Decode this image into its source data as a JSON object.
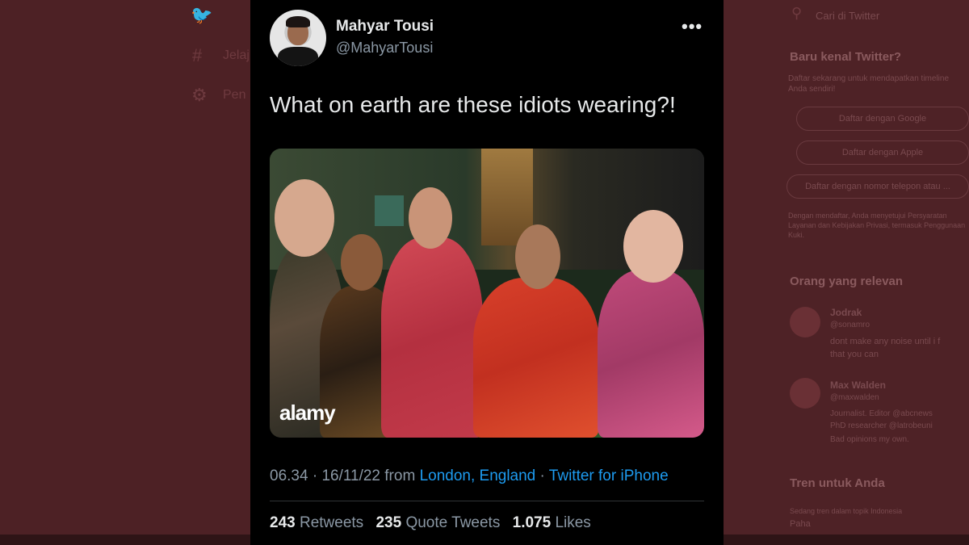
{
  "tweet": {
    "author_name": "Mahyar Tousi",
    "author_handle": "@MahyarTousi",
    "text": "What on earth are these idiots wearing?!",
    "photo_watermark": "alamy",
    "time": "06.34",
    "date": "16/11/22",
    "from_label": "from",
    "location": "London, England",
    "source": "Twitter for iPhone",
    "retweets_count": "243",
    "retweets_label": "Retweets",
    "quotes_count": "235",
    "quotes_label": "Quote Tweets",
    "likes_count": "1.075",
    "likes_label": "Likes",
    "sep": "·"
  },
  "background": {
    "nav": {
      "explore_label": "Jelaj",
      "settings_label": "Pen"
    },
    "search_placeholder": "Cari di Twitter",
    "new_to_twitter_title": "Baru kenal Twitter?",
    "new_to_twitter_desc": "Daftar sekarang untuk mendapatkan timeline",
    "new_to_twitter_desc2": "Anda sendiri!",
    "signup_google": "Daftar dengan Google",
    "signup_apple": "Daftar dengan Apple",
    "signup_phone": "Daftar dengan nomor telepon atau ...",
    "terms_line1": "Dengan mendaftar, Anda menyetujui Persyaratan",
    "terms_line2": "Layanan dan Kebijakan Privasi, termasuk Penggunaan",
    "terms_line3": "Kuki.",
    "relevant_title": "Orang yang relevan",
    "person1_name": "Jodrak",
    "person1_handle": "@sonamro",
    "person1_bio1": "dont make any noise until i f",
    "person1_bio2": "that you can",
    "person2_name": "Max Walden",
    "person2_handle": "@maxwalden",
    "person2_bio1": "Journalist. Editor @abcnews",
    "person2_bio2": "PhD researcher @latrobeuni",
    "person2_bio3": "Bad opinions my own.",
    "trends_title": "Tren untuk Anda",
    "trend1_context": "Sedang tren dalam topik Indonesia",
    "trend1_name": "Paha"
  },
  "colors": {
    "card_bg": "#000000",
    "link": "#1d9bf0",
    "secondary_text": "#8b98a5",
    "primary_text": "#e7e9ea",
    "overlay": "#4a2024"
  },
  "icons": {
    "twitter_logo": "bird-icon",
    "explore": "hashtag-icon",
    "settings": "gear-icon",
    "search": "search-icon",
    "more": "more-icon"
  }
}
